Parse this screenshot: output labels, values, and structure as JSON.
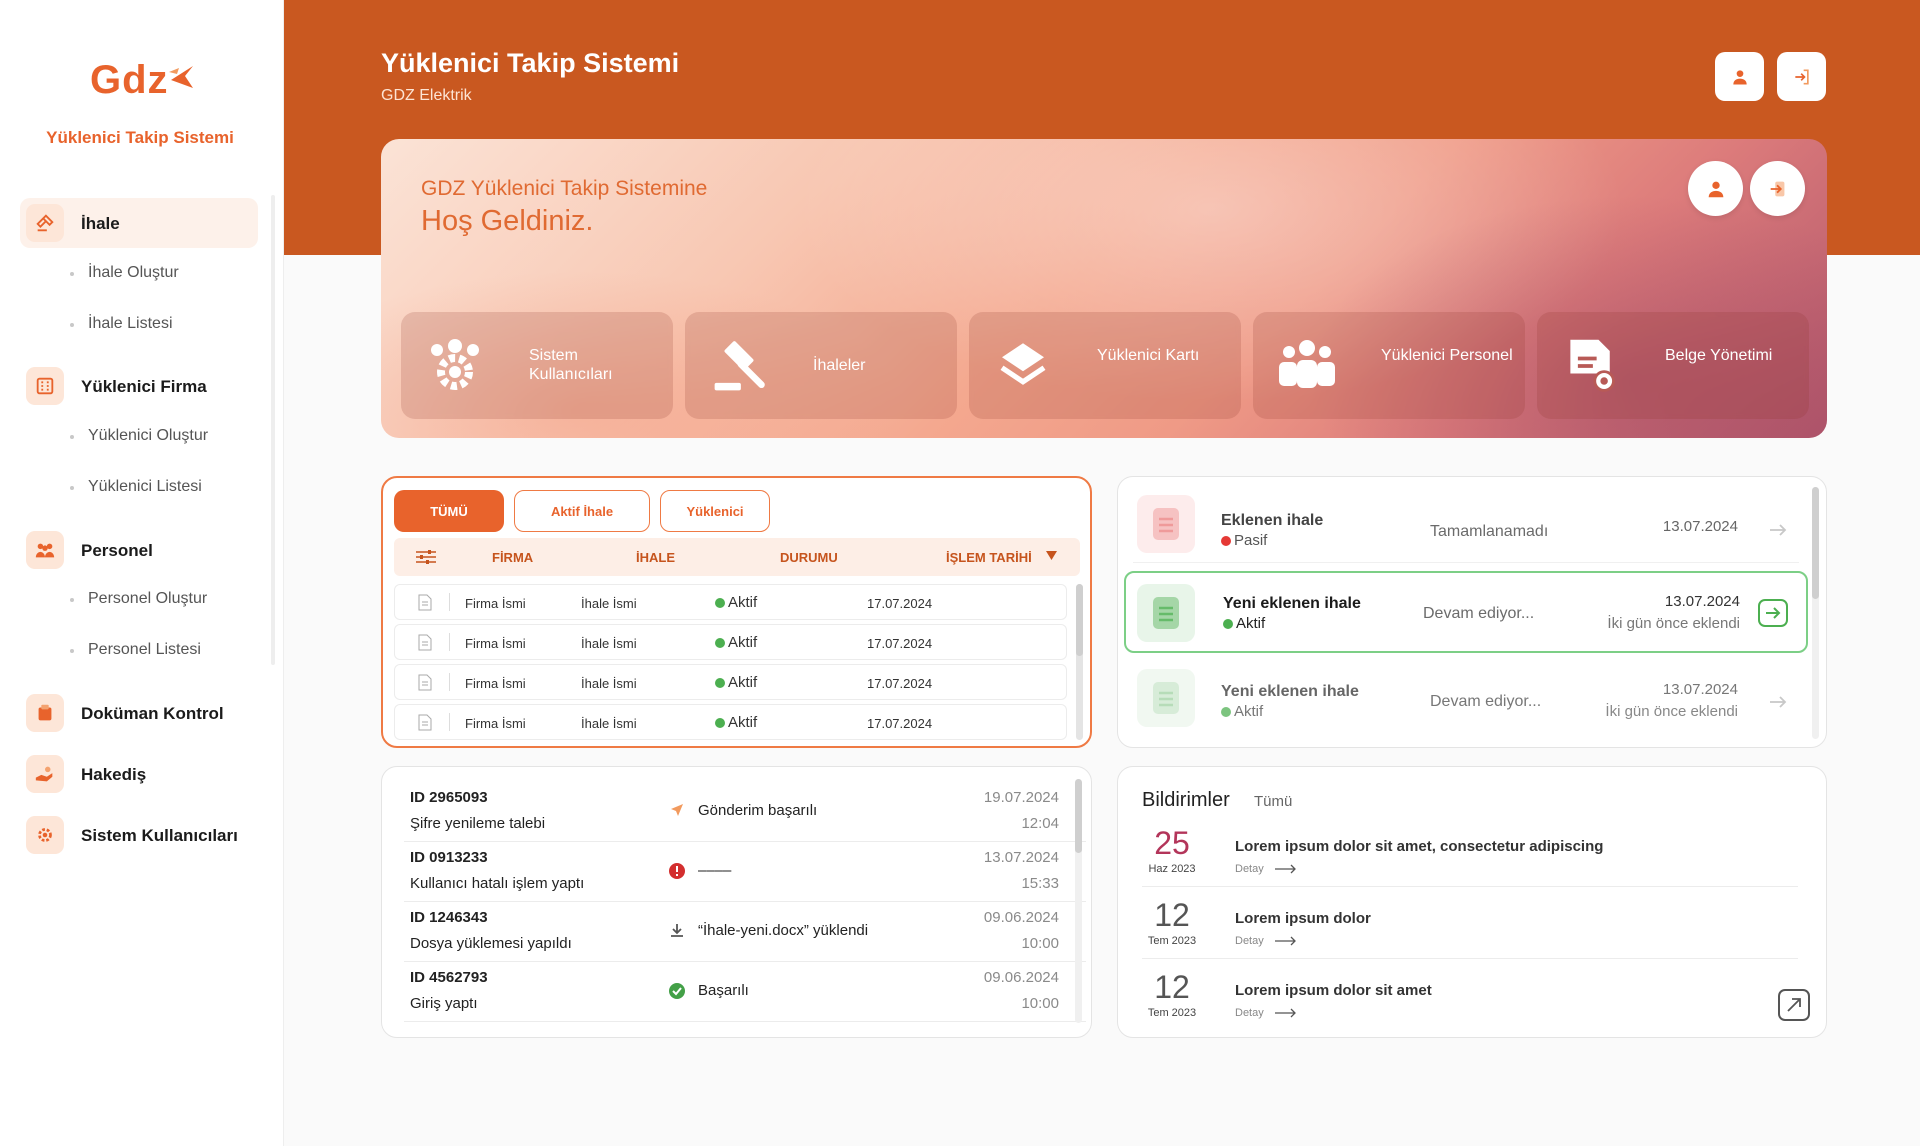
{
  "brand": {
    "logo_text": "Gdz",
    "name": "Yüklenici Takip Sistemi"
  },
  "sidebar": {
    "items": [
      {
        "label": "İhale",
        "icon": "gavel-icon",
        "active": true,
        "children": [
          "İhale Oluştur",
          "İhale Listesi"
        ]
      },
      {
        "label": "Yüklenici Firma",
        "icon": "building-icon",
        "children": [
          "Yüklenici Oluştur",
          "Yüklenici Listesi"
        ]
      },
      {
        "label": "Personel",
        "icon": "people-icon",
        "children": [
          "Personel Oluştur",
          "Personel Listesi"
        ]
      },
      {
        "label": "Doküman Kontrol",
        "icon": "document-icon",
        "children": []
      },
      {
        "label": "Hakediş",
        "icon": "hand-coin-icon",
        "children": []
      },
      {
        "label": "Sistem Kullanıcıları",
        "icon": "users-gear-icon",
        "children": []
      }
    ]
  },
  "header": {
    "title": "Yüklenici Takip Sistemi",
    "subtitle": "GDZ Elektrik"
  },
  "hero": {
    "line1": "GDZ Yüklenici Takip Sistemine",
    "line2": "Hoş Geldiniz.",
    "quick_actions": [
      {
        "label": "Sistem Kullanıcıları",
        "icon": "users-gear-icon"
      },
      {
        "label": "İhaleler",
        "icon": "gavel-icon"
      },
      {
        "label": "Yüklenici Kartı",
        "icon": "layers-icon"
      },
      {
        "label": "Yüklenici Personel",
        "icon": "team-icon"
      },
      {
        "label": "Belge Yönetimi",
        "icon": "document-settings-icon"
      }
    ]
  },
  "table": {
    "tabs": [
      "TÜMÜ",
      "Aktif İhale",
      "Yüklenici"
    ],
    "active_tab": 0,
    "columns": [
      "FİRMA",
      "İHALE",
      "DURUMU",
      "İŞLEM TARİHİ"
    ],
    "rows": [
      {
        "firma": "Firma İsmi",
        "ihale": "İhale İsmi",
        "durum": "Aktif",
        "tarih": "17.07.2024"
      },
      {
        "firma": "Firma İsmi",
        "ihale": "İhale İsmi",
        "durum": "Aktif",
        "tarih": "17.07.2024"
      },
      {
        "firma": "Firma İsmi",
        "ihale": "İhale İsmi",
        "durum": "Aktif",
        "tarih": "17.07.2024"
      },
      {
        "firma": "Firma İsmi",
        "ihale": "İhale İsmi",
        "durum": "Aktif",
        "tarih": "17.07.2024"
      }
    ]
  },
  "tenders": [
    {
      "title": "Eklenen ihale",
      "status": "Pasif",
      "status_color": "#e53935",
      "progress": "Tamamlanamadı",
      "date": "13.07.2024",
      "note": ""
    },
    {
      "title": "Yeni eklenen ihale",
      "status": "Aktif",
      "status_color": "#4caf50",
      "progress": "Devam ediyor...",
      "date": "13.07.2024",
      "note": "İki gün önce eklendi"
    },
    {
      "title": "Yeni eklenen ihale",
      "status": "Aktif",
      "status_color": "#4caf50",
      "progress": "Devam ediyor...",
      "date": "13.07.2024",
      "note": "İki gün önce eklendi"
    }
  ],
  "logs": [
    {
      "id": "ID 2965093",
      "desc": "Şifre yenileme talebi",
      "icon": "send-icon",
      "message": "Gönderim başarılı",
      "date": "19.07.2024",
      "time": "12:04"
    },
    {
      "id": "ID 0913233",
      "desc": "Kullanıcı hatalı işlem yaptı",
      "icon": "error-icon",
      "message": "––––",
      "date": "13.07.2024",
      "time": "15:33"
    },
    {
      "id": "ID 1246343",
      "desc": "Dosya yüklemesi yapıldı",
      "icon": "download-icon",
      "message": "“İhale-yeni.docx” yüklendi",
      "date": "09.06.2024",
      "time": "10:00"
    },
    {
      "id": "ID 4562793",
      "desc": "Giriş yaptı",
      "icon": "check-icon",
      "message": "Başarılı",
      "date": "09.06.2024",
      "time": "10:00"
    }
  ],
  "notifications": {
    "title": "Bildirimler",
    "all_link": "Tümü",
    "detail_label": "Detay",
    "items": [
      {
        "day": "25",
        "month": "Haz 2023",
        "text": "Lorem ipsum dolor sit amet, consectetur adipiscing",
        "color": "#b3355a"
      },
      {
        "day": "12",
        "month": "Tem 2023",
        "text": "Lorem ipsum dolor",
        "color": "#555555"
      },
      {
        "day": "12",
        "month": "Tem 2023",
        "text": "Lorem ipsum dolor sit amet",
        "color": "#555555"
      }
    ]
  },
  "colors": {
    "accent": "#e8632c",
    "header": "#c95820",
    "active": "#4caf50",
    "passive": "#e53935"
  }
}
